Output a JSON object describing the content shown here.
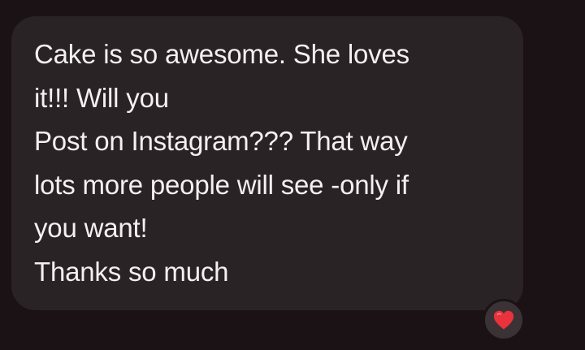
{
  "message": {
    "lines": [
      "Cake is so awesome. She loves",
      "it!!! Will you",
      "Post on Instagram??? That way",
      "lots more people will see -only if",
      "you want!",
      "Thanks so much"
    ]
  },
  "reaction": {
    "icon": "heart-icon",
    "color": "#e8323c"
  },
  "colors": {
    "background": "#1a1214",
    "bubble": "#2a2325",
    "text": "#f4eff0"
  }
}
